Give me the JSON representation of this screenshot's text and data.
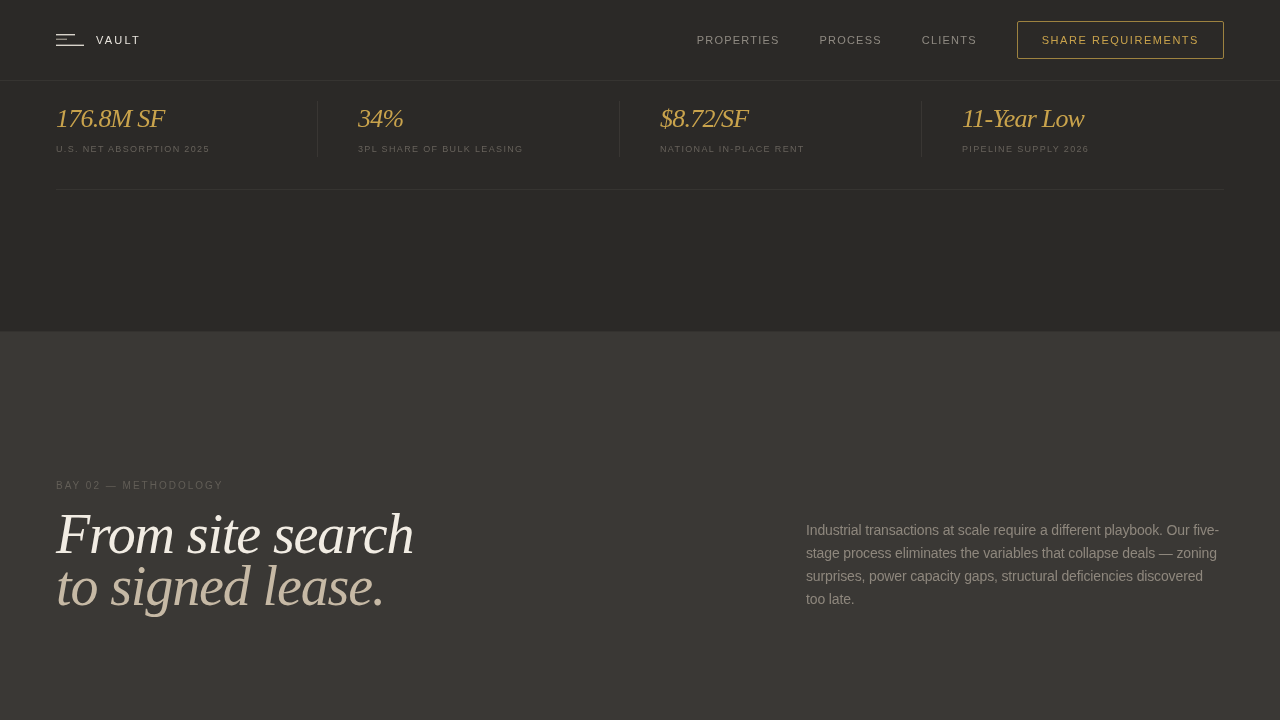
{
  "header": {
    "logo": "VAULT",
    "nav": [
      "PROPERTIES",
      "PROCESS",
      "CLIENTS"
    ],
    "cta": "SHARE REQUIREMENTS"
  },
  "stats": [
    {
      "value": "176.8M SF",
      "label": "U.S. NET ABSORPTION 2025"
    },
    {
      "value": "34%",
      "label": "3PL SHARE OF BULK LEASING"
    },
    {
      "value": "$8.72/SF",
      "label": "NATIONAL IN-PLACE RENT"
    },
    {
      "value": "11-Year Low",
      "label": "PIPELINE SUPPLY 2026"
    }
  ],
  "methodology": {
    "eyebrow": "BAY 02 — METHODOLOGY",
    "heading_lines": [
      "From site search",
      "to signed lease."
    ],
    "body": "Industrial transactions at scale require a different playbook. Our five-stage process eliminates the variables that collapse deals — zoning surprises, power capacity gaps, structural deficiencies discovered too late."
  }
}
